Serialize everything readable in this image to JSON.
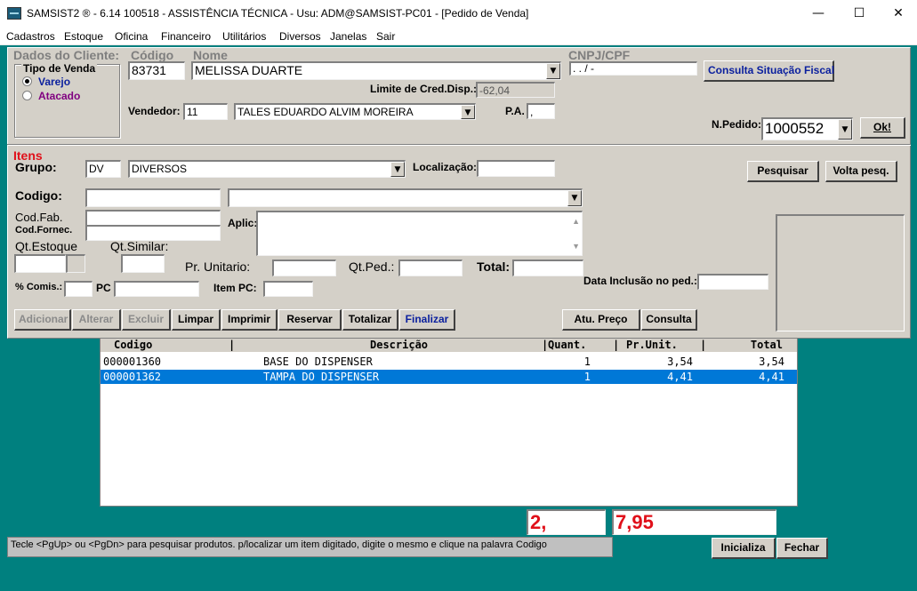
{
  "window": {
    "title": "SAMSIST2 ® - 6.14  100518 - ASSISTÊNCIA TÉCNICA - Usu: ADM@SAMSIST-PC01 - [Pedido de Venda]",
    "minimize": "—",
    "maximize": "☐",
    "close": "✕"
  },
  "menu": [
    "Cadastros",
    "Estoque",
    "Oficina",
    "Financeiro",
    "Utilitários",
    "Diversos",
    "Janelas",
    "Sair"
  ],
  "cliente": {
    "section_label": "Dados do Cliente:",
    "codigo_label": "Código",
    "codigo_value": "83731",
    "nome_label": "Nome",
    "nome_value": "MELISSA DUARTE",
    "cnpj_label": "CNPJ/CPF",
    "cnpj_value": " .   .   /    -",
    "consulta_fiscal_button": "Consulta Situação Fiscal",
    "limite_label": "Limite de Cred.Disp.:",
    "limite_value": "-62,04",
    "vendedor_label": "Vendedor:",
    "vendedor_code": "11",
    "vendedor_name": "TALES EDUARDO ALVIM MOREIRA",
    "pa_label": "P.A.",
    "pa_value": ",",
    "npedido_label": "N.Pedido:",
    "npedido_value": "1000552",
    "ok_button": "Ok!"
  },
  "tipo_venda": {
    "label": "Tipo de Venda",
    "options": [
      {
        "label": "Varejo",
        "selected": true,
        "color": "#0a1f9e"
      },
      {
        "label": "Atacado",
        "selected": false,
        "color": "#800080"
      }
    ]
  },
  "itens": {
    "section_label": "Itens",
    "grupo_label": "Grupo:",
    "grupo_code": "DV",
    "grupo_name": "DIVERSOS",
    "localizacao_label": "Localização:",
    "pesquisar_button": "Pesquisar",
    "volta_pesq_button": "Volta pesq.",
    "codigo_label": "Codigo:",
    "codfab_label": "Cod.Fab.",
    "codfornec_label": "Cod.Fornec.",
    "aplic_label": "Aplic:",
    "qtestoque_label": "Qt.Estoque",
    "qtsimilar_label": "Qt.Similar:",
    "prunitario_label": "Pr. Unitario:",
    "qtped_label": "Qt.Ped.:",
    "total_label": "Total:",
    "comis_label": "% Comis.:",
    "pc_label": "PC",
    "itempc_label": "Item PC:",
    "data_inclusao_label": "Data Inclusão no ped.:"
  },
  "actions": {
    "adicionar": "Adicionar",
    "alterar": "Alterar",
    "excluir": "Excluir",
    "limpar": "Limpar",
    "imprimir": "Imprimir",
    "reservar": "Reservar",
    "totalizar": "Totalizar",
    "finalizar": "Finalizar",
    "atu_preco": "Atu. Preço",
    "consulta": "Consulta"
  },
  "grid": {
    "columns": [
      "Codigo",
      "Descrição",
      "Quant.",
      "Pr.Unit.",
      "Total"
    ],
    "rows": [
      {
        "codigo": "000001360",
        "descricao": "BASE DO DISPENSER",
        "quant": "1",
        "pr_unit": "3,54",
        "total": "3,54",
        "selected": false
      },
      {
        "codigo": "000001362",
        "descricao": "TAMPA DO DISPENSER",
        "quant": "1",
        "pr_unit": "4,41",
        "total": "4,41",
        "selected": true
      }
    ]
  },
  "totals": {
    "qty": "2,",
    "amount": "7,95"
  },
  "status": {
    "text": "Tecle <PgUp> ou <PgDn> para pesquisar produtos. p/localizar um item digitado, digite o mesmo e clique na palavra Codigo"
  },
  "bottom_buttons": {
    "inicializa": "Inicializa",
    "fechar": "Fechar"
  }
}
